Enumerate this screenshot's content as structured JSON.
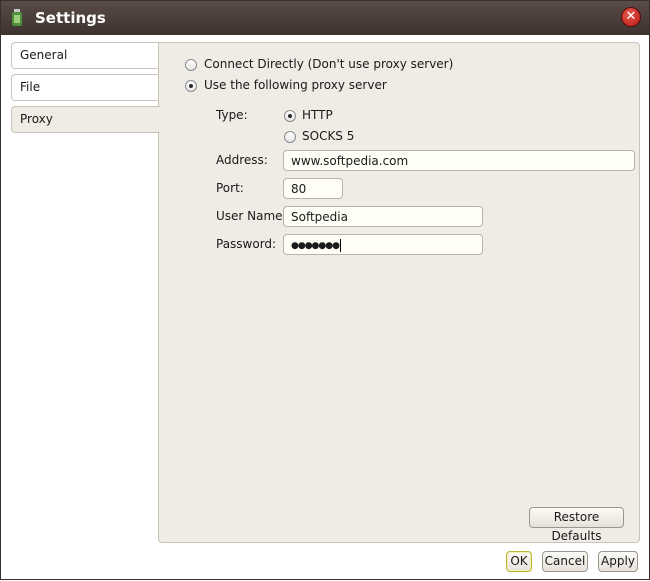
{
  "window": {
    "title": "Settings",
    "close_glyph": "✕"
  },
  "sidebar": {
    "items": [
      {
        "label": "General"
      },
      {
        "label": "File"
      },
      {
        "label": "Proxy"
      }
    ]
  },
  "proxy": {
    "connect_directly_label": "Connect Directly (Don't use proxy server)",
    "use_proxy_label": "Use the following proxy server",
    "mode": "use_proxy",
    "type_label": "Type:",
    "http_label": "HTTP",
    "socks_label": "SOCKS 5",
    "selected_type": "HTTP",
    "address_label": "Address:",
    "address_value": "www.softpedia.com",
    "port_label": "Port:",
    "port_value": "80",
    "username_label": "User Name:",
    "username_value": "Softpedia",
    "password_label": "Password:",
    "password_masked": "●●●●●●●"
  },
  "buttons": {
    "restore_defaults": "Restore Defaults",
    "ok": "OK",
    "cancel": "Cancel",
    "apply": "Apply"
  },
  "colors": {
    "titlebar": "#4a3e3a",
    "panel_bg": "#efebe5",
    "close_button": "#c9261c"
  }
}
